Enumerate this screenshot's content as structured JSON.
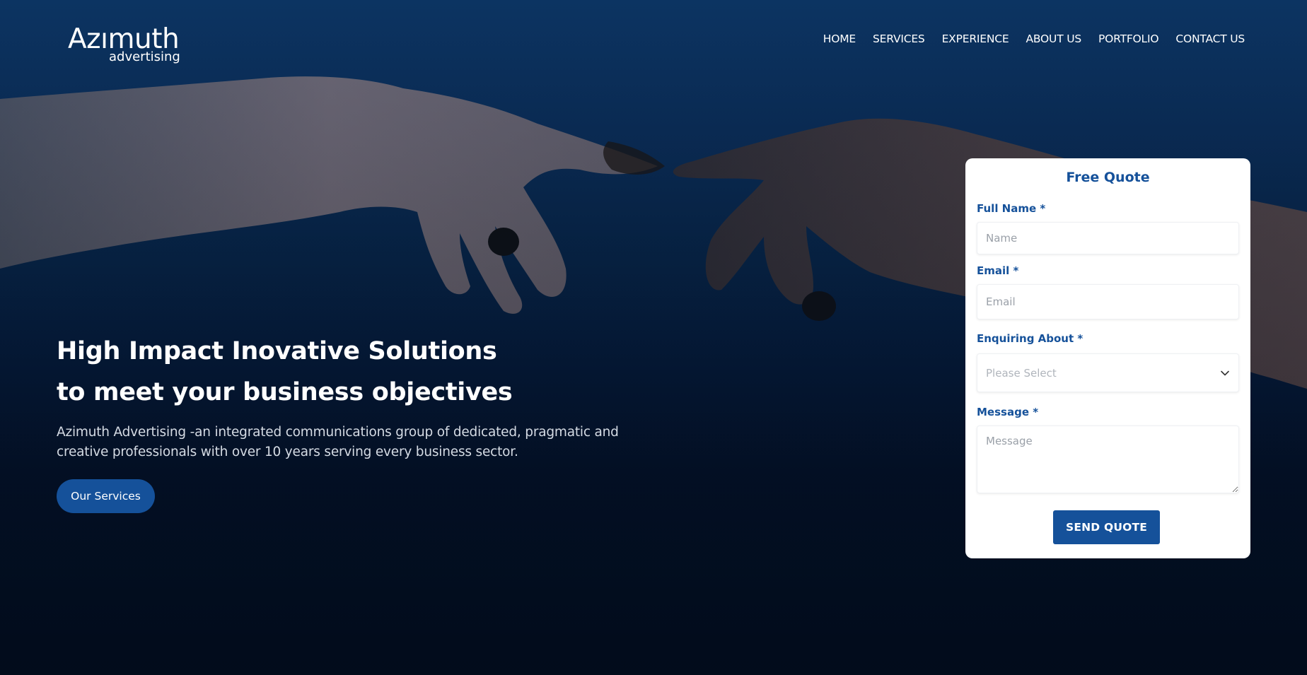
{
  "brand": {
    "name": "Azımuth",
    "tagline": "advertising"
  },
  "nav": {
    "items": [
      {
        "label": "HOME"
      },
      {
        "label": "SERVICES"
      },
      {
        "label": "EXPERIENCE"
      },
      {
        "label": "ABOUT US"
      },
      {
        "label": "PORTFOLIO"
      },
      {
        "label": "CONTACT US"
      }
    ]
  },
  "hero": {
    "headline_line1": "High Impact Inovative Solutions",
    "headline_line2": "to meet your business objectives",
    "description": "Azimuth Advertising -an integrated communications group of dedicated, pragmatic and creative professionals with over 10 years serving every business sector.",
    "cta_label": "Our Services"
  },
  "quote_form": {
    "title": "Free Quote",
    "full_name": {
      "label": "Full Name *",
      "placeholder": "Name"
    },
    "email": {
      "label": "Email *",
      "placeholder": "Email"
    },
    "enquiring": {
      "label": "Enquiring About *",
      "selected": "Please Select"
    },
    "message": {
      "label": "Message *",
      "placeholder": "Message"
    },
    "submit_label": "SEND QUOTE"
  },
  "colors": {
    "accent": "#15519a",
    "hero_top": "#0c3462",
    "hero_bottom": "#01060f"
  },
  "icons": {
    "select_chevron": "chevron-down-icon"
  }
}
